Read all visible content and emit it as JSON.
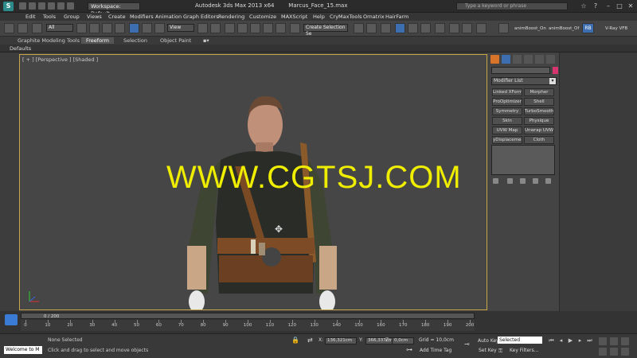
{
  "titlebar": {
    "workspace": "Workspace: Default",
    "title": "Autodesk 3ds Max  2013 x64",
    "file": "Marcus_Face_15.max",
    "search_placeholder": "Type a keyword or phrase"
  },
  "menubar": [
    "Edit",
    "Tools",
    "Group",
    "Views",
    "Create",
    "Modifiers",
    "Animation",
    "Graph Editors",
    "Rendering",
    "Customize",
    "MAXScript",
    "Help",
    "CryMaxTools",
    "Ornatrix",
    "HairFarm"
  ],
  "toolbar": {
    "filter": "All",
    "refcoord": "View",
    "selection_set": "Create Selection Se",
    "btn1": "animBoost_On",
    "btn2": "animBoost_Of",
    "rb": "RB",
    "vray": "V-Ray VFB"
  },
  "ribbon": {
    "tabs": [
      "Graphite Modeling Tools",
      "Freeform",
      "Selection",
      "Object Paint"
    ],
    "active": "Freeform"
  },
  "defaults_label": "Defaults",
  "viewport": {
    "label": "[ + ] [Perspective ] [Shaded ]",
    "watermark": "WWW.CGTSJ.COM"
  },
  "command_panel": {
    "modifier_list": "Modifier List",
    "buttons": [
      "Linked XForm",
      "Morpher",
      "ProOptimizer",
      "Shell",
      "Symmetry",
      "TurboSmooth",
      "Skin",
      "Physique",
      "UVW Map",
      "Unwrap UVW",
      "yDisplacement",
      "Cloth"
    ],
    "colors": {
      "swatch": "#d6336f"
    }
  },
  "timeline": {
    "slider": "0 / 200",
    "ticks": [
      "0",
      "10",
      "20",
      "30",
      "40",
      "50",
      "60",
      "70",
      "80",
      "90",
      "100",
      "110",
      "120",
      "130",
      "140",
      "150",
      "160",
      "170",
      "180",
      "190",
      "200"
    ]
  },
  "status": {
    "maxscript": "Welcome to M",
    "selection": "None Selected",
    "prompt": "Click and drag to select and move objects",
    "x_label": "X:",
    "x_value": "136,321cm",
    "y_label": "Y:",
    "y_value": "366,337cm",
    "z_label": "Z:",
    "z_value": "0,0cm",
    "grid": "Grid = 10,0cm",
    "add_time_tag": "Add Time Tag",
    "auto_key": "Auto Key",
    "set_key": "Set Key",
    "selected": "Selected",
    "key_filters": "Key Filters..."
  }
}
